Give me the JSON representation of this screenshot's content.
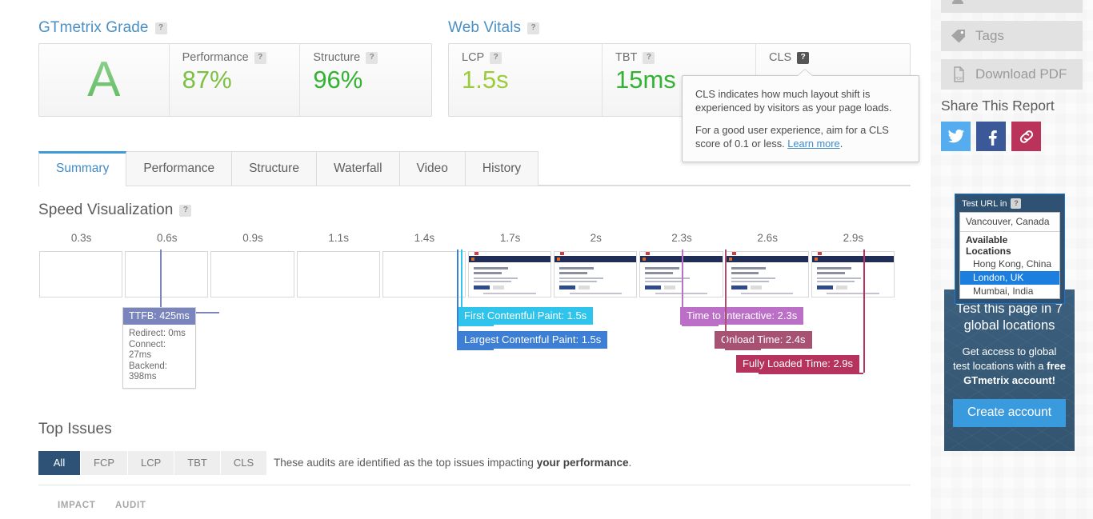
{
  "gtmetrix_grade": {
    "heading": "GTmetrix Grade",
    "help": "?",
    "grade": "A",
    "metrics": [
      {
        "label": "Performance",
        "help": "?",
        "value": "87%",
        "color": "#7cc142"
      },
      {
        "label": "Structure",
        "help": "?",
        "value": "96%",
        "color": "#34b233"
      }
    ]
  },
  "web_vitals": {
    "heading": "Web Vitals",
    "help": "?",
    "metrics": [
      {
        "label": "LCP",
        "help": "?",
        "value": "1.5s",
        "color": "#9ccc3c"
      },
      {
        "label": "TBT",
        "help": "?",
        "value": "15ms",
        "color": "#34b233"
      },
      {
        "label": "CLS",
        "help": "?",
        "value": "",
        "color": "#34b233"
      }
    ]
  },
  "tooltip": {
    "p1": "CLS indicates how much layout shift is experienced by visitors as your page loads.",
    "p2_before": "For a good user experience, aim for a CLS score of 0.1 or less. ",
    "link": "Learn more",
    "p2_after": "."
  },
  "tabs": [
    {
      "label": "Summary",
      "active": true
    },
    {
      "label": "Performance",
      "active": false
    },
    {
      "label": "Structure",
      "active": false
    },
    {
      "label": "Waterfall",
      "active": false
    },
    {
      "label": "Video",
      "active": false
    },
    {
      "label": "History",
      "active": false
    }
  ],
  "speed_visualization": {
    "heading": "Speed Visualization",
    "help": "?",
    "ticks": [
      "0.3s",
      "0.6s",
      "0.9s",
      "1.1s",
      "1.4s",
      "1.7s",
      "2s",
      "2.3s",
      "2.6s",
      "2.9s"
    ],
    "ttfb": {
      "title": "TTFB: 425ms",
      "rows": [
        "Redirect: 0ms",
        "Connect: 27ms",
        "Backend: 398ms"
      ]
    },
    "badges": [
      {
        "label": "First Contentful Paint: 1.5s",
        "color": "#2ec4ec"
      },
      {
        "label": "Largest Contentful Paint: 1.5s",
        "color": "#3d7fd4"
      },
      {
        "label": "Time to Interactive: 2.3s",
        "color": "#bb6fc7"
      },
      {
        "label": "Onload Time: 2.4s",
        "color": "#a85273"
      },
      {
        "label": "Fully Loaded Time: 2.9s",
        "color": "#b5335c"
      }
    ]
  },
  "top_issues": {
    "heading": "Top Issues",
    "filters": [
      {
        "label": "All",
        "active": true
      },
      {
        "label": "FCP",
        "active": false
      },
      {
        "label": "LCP",
        "active": false
      },
      {
        "label": "TBT",
        "active": false
      },
      {
        "label": "CLS",
        "active": false
      }
    ],
    "note_before": "These audits are identified as the top issues impacting ",
    "note_bold": "your performance",
    "note_after": ".",
    "columns": [
      "IMPACT",
      "AUDIT"
    ]
  },
  "sidebar": {
    "buttons": [
      {
        "label": "Tags",
        "icon": "tag-icon"
      },
      {
        "label": "Download PDF",
        "icon": "pdf-icon"
      }
    ],
    "share_title": "Share This Report",
    "share": [
      {
        "name": "twitter-share-button",
        "glyph": "🐦"
      },
      {
        "name": "facebook-share-button",
        "glyph": "f"
      },
      {
        "name": "link-share-button",
        "glyph": "🔗"
      }
    ],
    "location": {
      "title": "Test URL in",
      "help": "?",
      "current": "Vancouver, Canada",
      "group_label": "Available Locations",
      "options": [
        {
          "label": "Hong Kong, China",
          "selected": false
        },
        {
          "label": "London, UK",
          "selected": true
        },
        {
          "label": "Mumbai, India",
          "selected": false
        }
      ]
    },
    "promo": {
      "heading": "Test this page in 7 global locations",
      "body_before": "Get access to global test locations with a ",
      "body_bold": "free GTmetrix account!",
      "button": "Create account"
    }
  }
}
